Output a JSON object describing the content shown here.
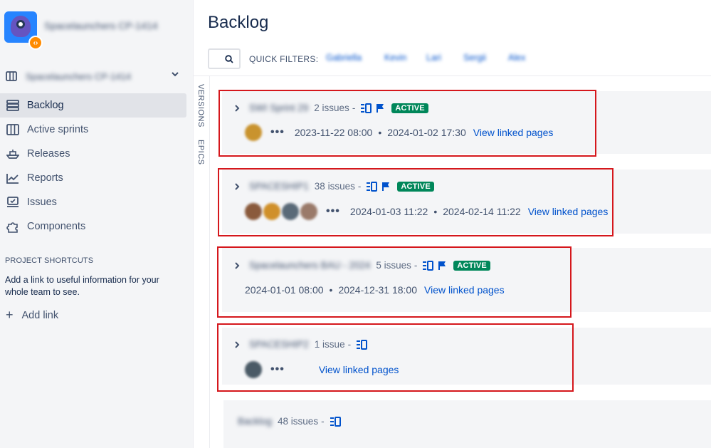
{
  "sidebar": {
    "project_name": "Spacelaunchers CP-1414",
    "badge_glyph": "‹›",
    "board_selector": "Spacelaunchers CP-1414",
    "items": [
      {
        "label": "Backlog",
        "icon": "backlog-icon",
        "active": true
      },
      {
        "label": "Active sprints",
        "icon": "board-icon",
        "active": false
      },
      {
        "label": "Releases",
        "icon": "ship-icon",
        "active": false
      },
      {
        "label": "Reports",
        "icon": "chart-icon",
        "active": false
      },
      {
        "label": "Issues",
        "icon": "issues-icon",
        "active": false
      },
      {
        "label": "Components",
        "icon": "puzzle-icon",
        "active": false
      }
    ],
    "shortcuts_heading": "PROJECT SHORTCUTS",
    "shortcuts_desc": "Add a link to useful information for your whole team to see.",
    "add_link": "Add link"
  },
  "main": {
    "title": "Backlog",
    "quick_filters_label": "QUICK FILTERS:",
    "quick_filters": [
      "Gabriella",
      "Kevin",
      "Lari",
      "Sergii",
      "Alex"
    ],
    "side_tabs": [
      "VERSIONS",
      "EPICS"
    ]
  },
  "sprints": [
    {
      "name": "SWI Sprint 29",
      "count": "2 issues",
      "active": true,
      "status": "ACTIVE",
      "avatars": [
        "#c9932e"
      ],
      "start": "2023-11-22 08:00",
      "end": "2024-01-02 17:30",
      "link": "View linked pages"
    },
    {
      "name": "SPACESHIP1",
      "count": "38 issues",
      "active": true,
      "status": "ACTIVE",
      "avatars": [
        "#8a5a3c",
        "#d0902a",
        "#5a6a78",
        "#9a7a6a"
      ],
      "start": "2024-01-03 11:22",
      "end": "2024-02-14 11:22",
      "link": "View linked pages"
    },
    {
      "name": "Spacelaunchers BAU - 2024",
      "count": "5 issues",
      "active": true,
      "status": "ACTIVE",
      "avatars": [],
      "start": "2024-01-01 08:00",
      "end": "2024-12-31 18:00",
      "link": "View linked pages"
    },
    {
      "name": "SPACESHIP2",
      "count": "1 issue",
      "active": false,
      "status": "",
      "avatars": [
        "#4a5a66"
      ],
      "start": "",
      "end": "",
      "link": "View linked pages"
    }
  ],
  "backlog": {
    "name": "Backlog",
    "count": "48 issues"
  },
  "colors": {
    "accent": "#0052cc",
    "active_lozenge": "#00875a",
    "highlight": "#d5171c"
  }
}
